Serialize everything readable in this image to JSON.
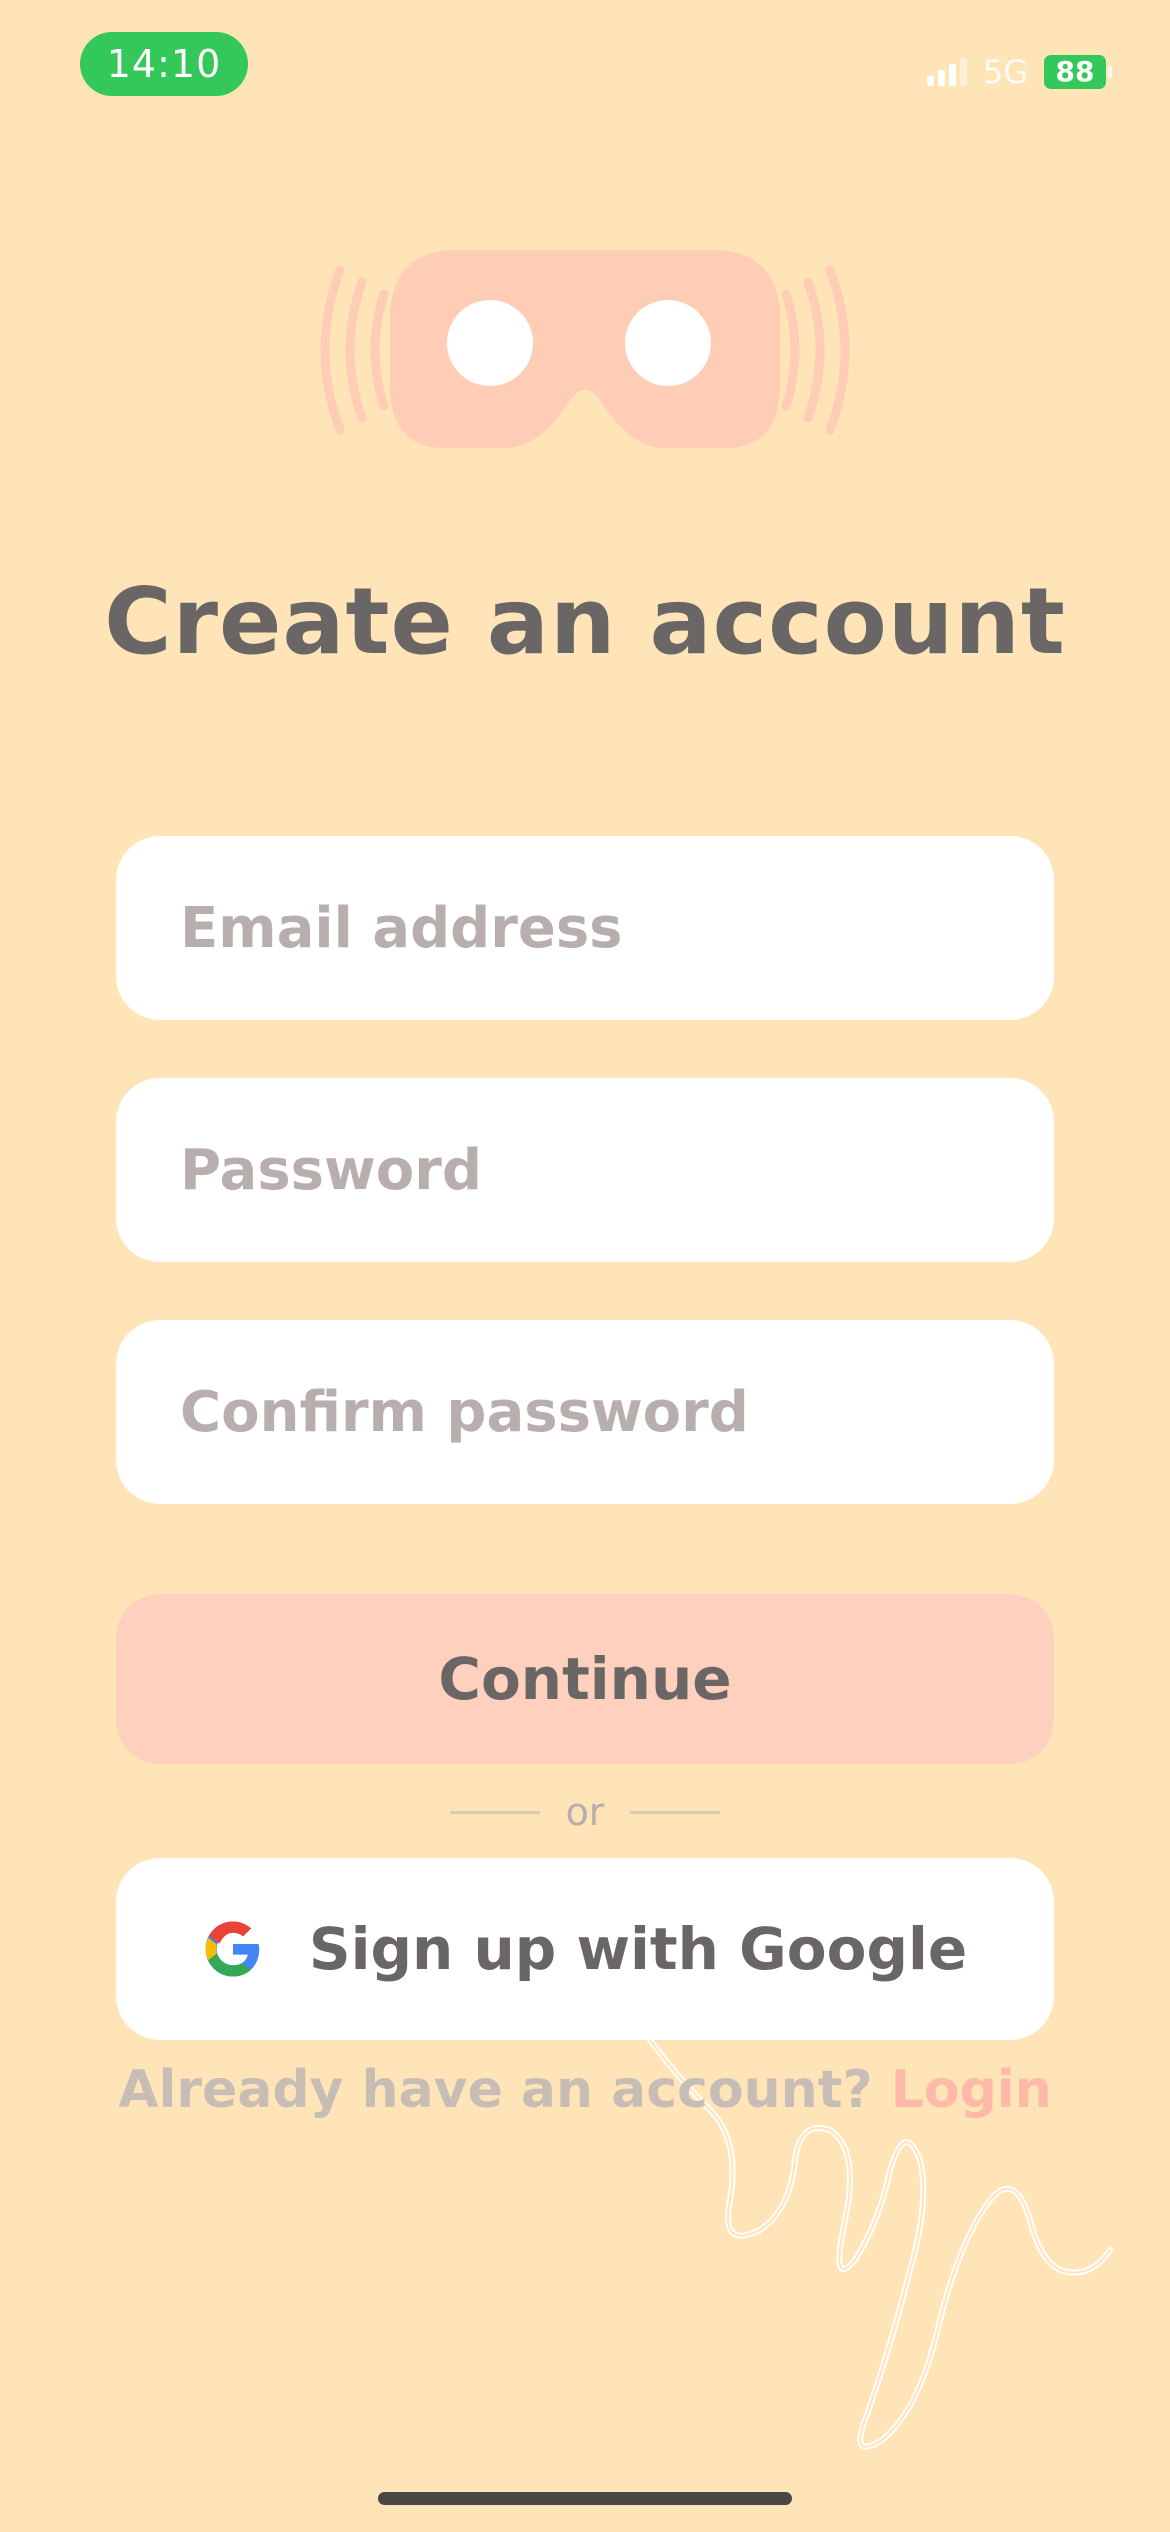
{
  "status_bar": {
    "time": "14:10",
    "network": "5G",
    "battery": "88"
  },
  "screen": {
    "title": "Create an account"
  },
  "form": {
    "email_placeholder": "Email address",
    "password_placeholder": "Password",
    "confirm_placeholder": "Confirm password",
    "continue_label": "Continue"
  },
  "divider": {
    "text": "or"
  },
  "google": {
    "label": "Sign up with Google",
    "icon": "google-icon"
  },
  "footer": {
    "prompt": "Already have an account?",
    "login_label": "Login"
  },
  "colors": {
    "background": "#FFE4B8",
    "accent": "#FFD0BE",
    "link": "#FFB9A8",
    "text": "#6B6666",
    "status_green": "#34C759"
  }
}
